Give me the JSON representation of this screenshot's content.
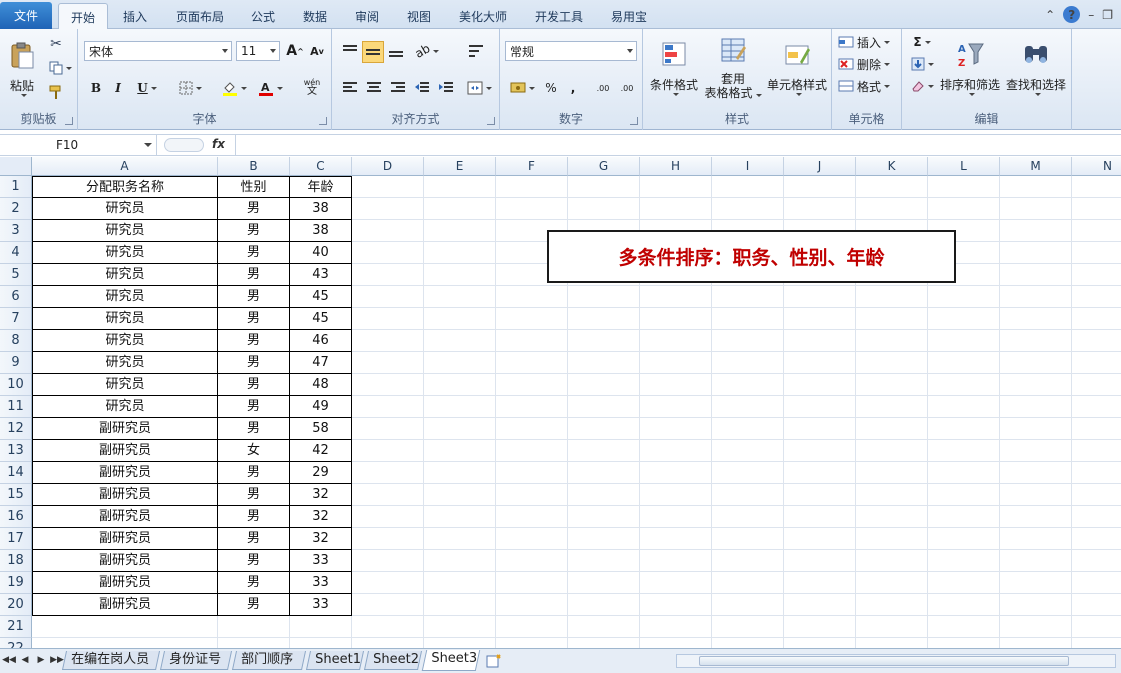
{
  "ribbon_tabs": {
    "file": "文件",
    "tabs": [
      "开始",
      "插入",
      "页面布局",
      "公式",
      "数据",
      "审阅",
      "视图",
      "美化大师",
      "开发工具",
      "易用宝"
    ]
  },
  "clipboard": {
    "paste": "粘贴",
    "label": "剪贴板"
  },
  "font": {
    "name": "宋体",
    "size": "11",
    "label": "字体",
    "bold": "B",
    "italic": "I",
    "underline": "U",
    "phonetic": "wén",
    "grow": "A",
    "shrink": "A"
  },
  "alignment": {
    "label": "对齐方式"
  },
  "number": {
    "format": "常规",
    "label": "数字",
    "percent": "%",
    "comma": ",",
    "inc_dec": ".00",
    "dec_dec": ".00"
  },
  "styles": {
    "conditional": "条件格式",
    "table_fmt_1": "套用",
    "table_fmt_2": "表格格式",
    "cell_styles": "单元格样式",
    "label": "样式"
  },
  "cells": {
    "insert": "插入",
    "delete": "删除",
    "format": "格式",
    "label": "单元格"
  },
  "editing": {
    "sort": "排序和筛选",
    "find": "查找和选择",
    "label": "编辑"
  },
  "formula_bar": {
    "name_box": "F10",
    "fx": "fx",
    "formula": ""
  },
  "columns": [
    "A",
    "B",
    "C",
    "D",
    "E",
    "F",
    "G",
    "H",
    "I",
    "J",
    "K",
    "L",
    "M",
    "N"
  ],
  "rows": [
    "1",
    "2",
    "3",
    "4",
    "5",
    "6",
    "7",
    "8",
    "9",
    "10",
    "11",
    "12",
    "13",
    "14",
    "15",
    "16",
    "17",
    "18",
    "19",
    "20",
    "21",
    "22"
  ],
  "table": {
    "headers": [
      "分配职务名称",
      "性别",
      "年龄"
    ],
    "rows": [
      [
        "研究员",
        "男",
        "38"
      ],
      [
        "研究员",
        "男",
        "38"
      ],
      [
        "研究员",
        "男",
        "40"
      ],
      [
        "研究员",
        "男",
        "43"
      ],
      [
        "研究员",
        "男",
        "45"
      ],
      [
        "研究员",
        "男",
        "45"
      ],
      [
        "研究员",
        "男",
        "46"
      ],
      [
        "研究员",
        "男",
        "47"
      ],
      [
        "研究员",
        "男",
        "48"
      ],
      [
        "研究员",
        "男",
        "49"
      ],
      [
        "副研究员",
        "男",
        "58"
      ],
      [
        "副研究员",
        "女",
        "42"
      ],
      [
        "副研究员",
        "男",
        "29"
      ],
      [
        "副研究员",
        "男",
        "32"
      ],
      [
        "副研究员",
        "男",
        "32"
      ],
      [
        "副研究员",
        "男",
        "32"
      ],
      [
        "副研究员",
        "男",
        "33"
      ],
      [
        "副研究员",
        "男",
        "33"
      ],
      [
        "副研究员",
        "男",
        "33"
      ]
    ]
  },
  "note": "多条件排序：职务、性别、年龄",
  "sheets": [
    "在编在岗人员",
    "身份证号",
    "部门顺序",
    "Sheet1",
    "Sheet2",
    "Sheet3"
  ],
  "active_sheet": "Sheet3",
  "colors": {
    "accent": "#1f63b6",
    "note_text": "#c00000"
  }
}
